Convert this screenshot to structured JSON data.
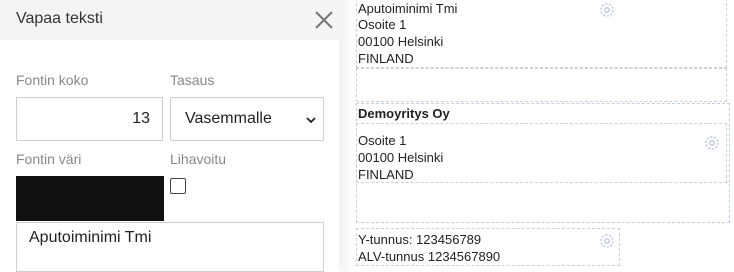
{
  "panel": {
    "title": "Vapaa teksti",
    "font_size_label": "Fontin koko",
    "font_size_value": "13",
    "align_label": "Tasaus",
    "align_value": "Vasemmalle",
    "font_color_label": "Fontin väri",
    "font_color_value": "#111111",
    "bold_label": "Lihavoitu",
    "bold_checked": false,
    "text_value": "Aputoiminimi Tmi"
  },
  "preview": {
    "sender_block": {
      "lines": [
        "Aputoiminimi Tmi",
        "Osoite 1",
        "00100 Helsinki",
        "FINLAND"
      ]
    },
    "recipient_block": {
      "name": "Demoyritys Oy",
      "lines": [
        "Osoite 1",
        "00100 Helsinki",
        "FINLAND"
      ]
    },
    "ids_block": {
      "lines": [
        "Y-tunnus: 123456789",
        "ALV-tunnus 1234567890"
      ]
    }
  },
  "icons": {
    "close": "close-icon",
    "chevron": "chevron-down-icon",
    "settings": "gear-icon"
  },
  "colors": {
    "gear": "#c3cbe0",
    "swatch": "#111111"
  }
}
